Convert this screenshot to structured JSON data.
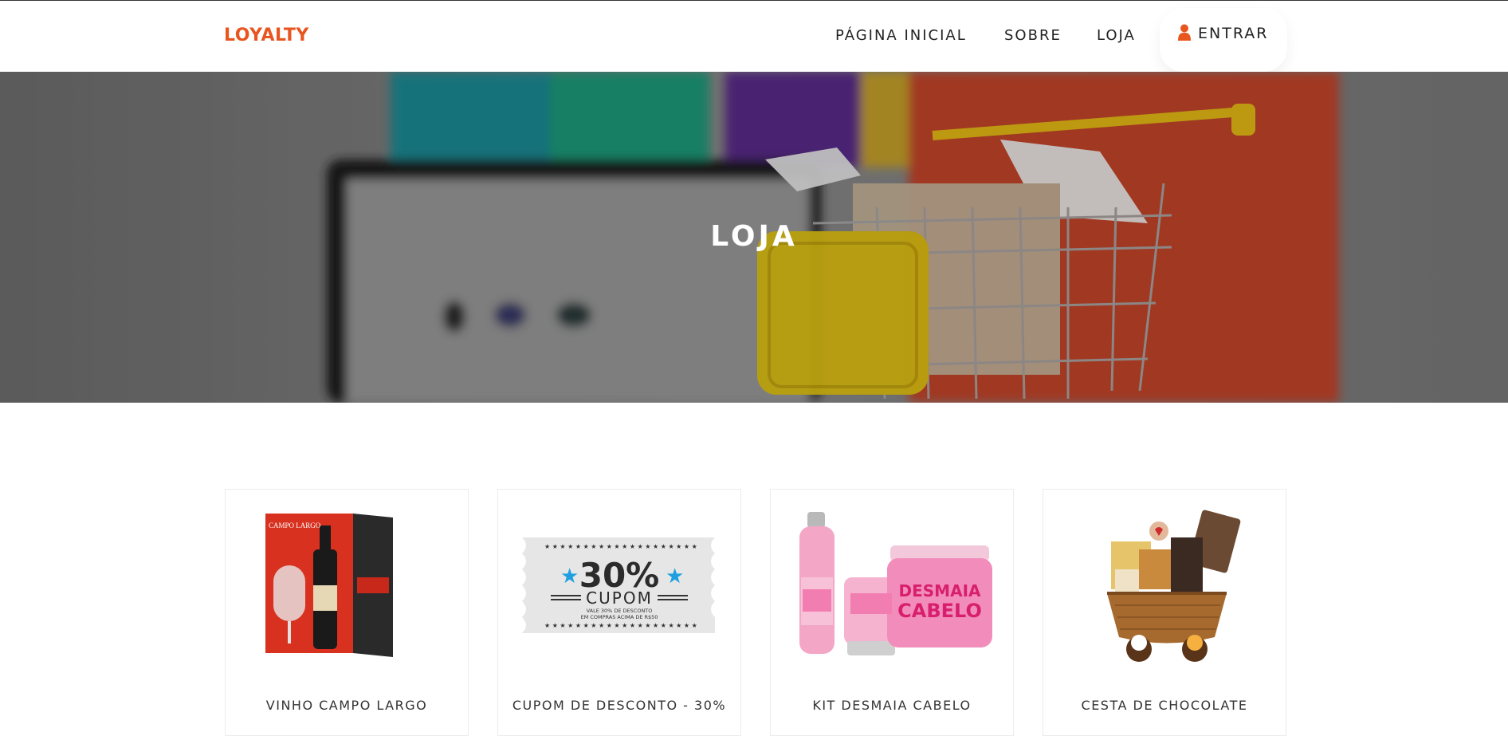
{
  "nav": {
    "logo": "LOYALTY",
    "home": "PÁGINA INICIAL",
    "about": "SOBRE",
    "shop": "LOJA",
    "login": "ENTRAR",
    "login_icon": "user-icon"
  },
  "hero": {
    "title": "LOJA"
  },
  "products": [
    {
      "name": "VINHO CAMPO LARGO",
      "image_icon": "wine-box-image",
      "brand_text": "CAMPO LARGO"
    },
    {
      "name": "CUPOM DE DESCONTO - 30%",
      "image_icon": "coupon-image",
      "percent": "30%",
      "coupon_word": "CUPOM",
      "fine_print_1": "VALE 30% DE DESCONTO",
      "fine_print_2": "EM COMPRAS ACIMA DE R$50"
    },
    {
      "name": "KIT DESMAIA CABELO",
      "image_icon": "hair-kit-image",
      "label_1": "DESMAIA",
      "label_2": "CABELO"
    },
    {
      "name": "CESTA DE CHOCOLATE",
      "image_icon": "chocolate-basket-image"
    }
  ],
  "colors": {
    "accent": "#e8551f",
    "text": "#222222",
    "card_border": "#ececec"
  }
}
